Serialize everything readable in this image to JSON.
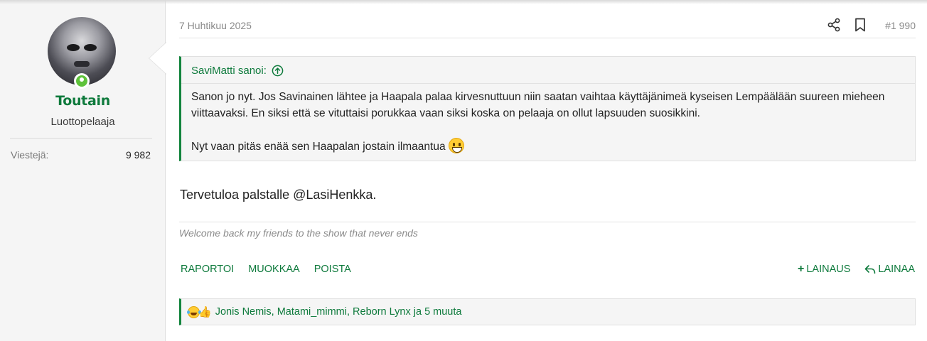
{
  "user": {
    "name": "Toutain",
    "title": "Luottopelaaja",
    "stat_label": "Viestejä:",
    "stat_value": "9 982"
  },
  "post": {
    "date": "7 Huhtikuu 2025",
    "number": "#1 990",
    "quote": {
      "author": "SaviMatti sanoi:",
      "paragraph1": "Sanon jo nyt. Jos Savinainen lähtee ja Haapala palaa kirvesnuttuun niin saatan vaihtaa käyttäjänimeä kyseisen Lempäälään suureen mieheen viittaavaksi. En siksi että se vituttaisi porukkaa vaan siksi koska on pelaaja on ollut lapsuuden suosikkini.",
      "paragraph2": "Nyt vaan pitäs enää sen Haapalan jostain ilmaantua"
    },
    "message": "Tervetuloa palstalle @LasiHenkka.",
    "signature": "Welcome back my friends to the show that never ends"
  },
  "actions": {
    "report": "RAPORTOI",
    "edit": "MUOKKAA",
    "delete": "POISTA",
    "multiquote": "LAINAUS",
    "reply": "LAINAA"
  },
  "reactions": {
    "text": "Jonis Nemis, Matami_mimmi, Reborn Lynx ja 5 muuta",
    "icons": [
      "laugh-icon",
      "like-icon"
    ]
  },
  "colors": {
    "accent": "#0e7a3c",
    "sidebar_bg": "#f5f5f5",
    "online": "#5ec23a"
  }
}
